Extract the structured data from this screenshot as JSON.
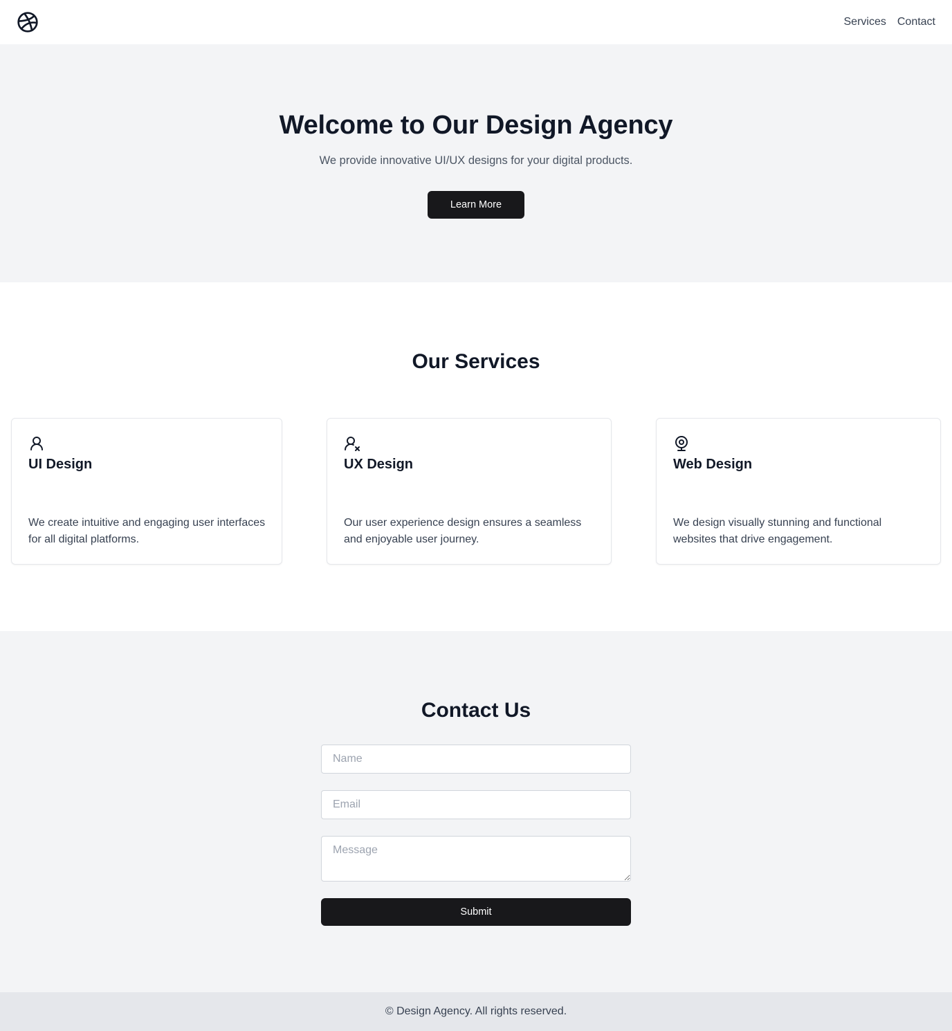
{
  "header": {
    "logo_icon": "dribbble-icon",
    "nav": [
      {
        "label": "Services"
      },
      {
        "label": "Contact"
      }
    ]
  },
  "hero": {
    "title": "Welcome to Our Design Agency",
    "subtitle": "We provide innovative UI/UX designs for your digital products.",
    "button_label": "Learn More"
  },
  "services": {
    "heading": "Our Services",
    "cards": [
      {
        "icon": "user-icon",
        "title": "UI Design",
        "description": "We create intuitive and engaging user interfaces for all digital platforms."
      },
      {
        "icon": "user-x-icon",
        "title": "UX Design",
        "description": "Our user experience design ensures a seamless and enjoyable user journey."
      },
      {
        "icon": "webcam-icon",
        "title": "Web Design",
        "description": "We design visually stunning and functional websites that drive engagement."
      }
    ]
  },
  "contact": {
    "heading": "Contact Us",
    "name_placeholder": "Name",
    "email_placeholder": "Email",
    "message_placeholder": "Message",
    "submit_label": "Submit"
  },
  "footer": {
    "text": "© Design Agency. All rights reserved."
  },
  "colors": {
    "primary_button": "#18181b",
    "section_bg": "#f3f4f6",
    "footer_bg": "#e5e7eb",
    "text_dark": "#111827"
  }
}
